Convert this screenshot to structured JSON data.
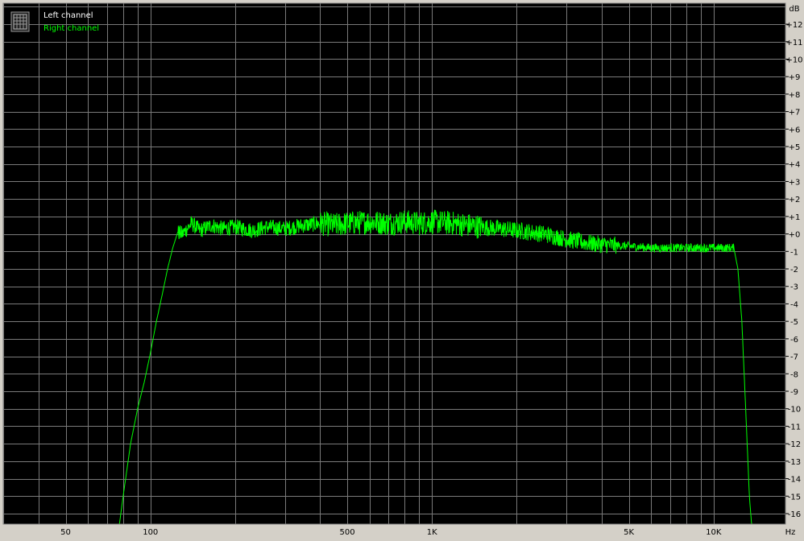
{
  "chart_data": {
    "type": "line",
    "x_scale": "log",
    "xlim": [
      30,
      18000
    ],
    "ylim": [
      -16.6,
      13.2
    ],
    "y_unit": "dB",
    "x_unit": "Hz",
    "x_tick_labels": [
      {
        "value": 50,
        "label": "50"
      },
      {
        "value": 100,
        "label": "100"
      },
      {
        "value": 500,
        "label": "500"
      },
      {
        "value": 1000,
        "label": "1K"
      },
      {
        "value": 5000,
        "label": "5K"
      },
      {
        "value": 10000,
        "label": "10K"
      }
    ],
    "y_tick_labels": [
      {
        "value": 12,
        "label": "+12"
      },
      {
        "value": 11,
        "label": "+11"
      },
      {
        "value": 10,
        "label": "+10"
      },
      {
        "value": 9,
        "label": "+9"
      },
      {
        "value": 8,
        "label": "+8"
      },
      {
        "value": 7,
        "label": "+7"
      },
      {
        "value": 6,
        "label": "+6"
      },
      {
        "value": 5,
        "label": "+5"
      },
      {
        "value": 4,
        "label": "+4"
      },
      {
        "value": 3,
        "label": "+3"
      },
      {
        "value": 2,
        "label": "+2"
      },
      {
        "value": 1,
        "label": "+1"
      },
      {
        "value": 0,
        "label": "+0"
      },
      {
        "value": -1,
        "label": "-1"
      },
      {
        "value": -2,
        "label": "-2"
      },
      {
        "value": -3,
        "label": "-3"
      },
      {
        "value": -4,
        "label": "-4"
      },
      {
        "value": -5,
        "label": "-5"
      },
      {
        "value": -6,
        "label": "-6"
      },
      {
        "value": -7,
        "label": "-7"
      },
      {
        "value": -8,
        "label": "-8"
      },
      {
        "value": -9,
        "label": "-9"
      },
      {
        "value": -10,
        "label": "-10"
      },
      {
        "value": -11,
        "label": "-11"
      },
      {
        "value": -12,
        "label": "-12"
      },
      {
        "value": -13,
        "label": "-13"
      },
      {
        "value": -14,
        "label": "-14"
      },
      {
        "value": -15,
        "label": "-15"
      },
      {
        "value": -16,
        "label": "-16"
      }
    ],
    "grid": true,
    "legend_position": "top-left",
    "legend": [
      {
        "name": "Left channel",
        "color": "#ffffff"
      },
      {
        "name": "Right channel",
        "color": "#00ff00"
      }
    ],
    "series": [
      {
        "name": "Right channel",
        "color": "#00ff00",
        "points": [
          [
            77,
            -17.0
          ],
          [
            80,
            -15.0
          ],
          [
            85,
            -12.0
          ],
          [
            90,
            -10.0
          ],
          [
            95,
            -8.5
          ],
          [
            100,
            -6.8
          ],
          [
            105,
            -5.0
          ],
          [
            110,
            -3.5
          ],
          [
            115,
            -2.0
          ],
          [
            120,
            -0.8
          ],
          [
            125,
            0.1
          ],
          [
            130,
            0.0
          ],
          [
            140,
            0.6
          ],
          [
            150,
            0.2
          ],
          [
            165,
            0.5
          ],
          [
            180,
            0.3
          ],
          [
            200,
            0.4
          ],
          [
            230,
            0.2
          ],
          [
            260,
            0.4
          ],
          [
            300,
            0.3
          ],
          [
            350,
            0.5
          ],
          [
            400,
            0.6
          ],
          [
            450,
            0.5
          ],
          [
            500,
            0.6
          ],
          [
            600,
            0.7
          ],
          [
            700,
            0.6
          ],
          [
            800,
            0.7
          ],
          [
            900,
            0.6
          ],
          [
            1000,
            0.7
          ],
          [
            1200,
            0.6
          ],
          [
            1500,
            0.4
          ],
          [
            2000,
            0.2
          ],
          [
            2500,
            0.0
          ],
          [
            3000,
            -0.3
          ],
          [
            3500,
            -0.5
          ],
          [
            4000,
            -0.6
          ],
          [
            5000,
            -0.7
          ],
          [
            6000,
            -0.8
          ],
          [
            7000,
            -0.8
          ],
          [
            8000,
            -0.8
          ],
          [
            9000,
            -0.8
          ],
          [
            10000,
            -0.8
          ],
          [
            11000,
            -0.8
          ],
          [
            11800,
            -0.8
          ],
          [
            12200,
            -2.0
          ],
          [
            12600,
            -5.0
          ],
          [
            13000,
            -10.0
          ],
          [
            13400,
            -15.0
          ],
          [
            13700,
            -17.0
          ]
        ]
      }
    ]
  }
}
